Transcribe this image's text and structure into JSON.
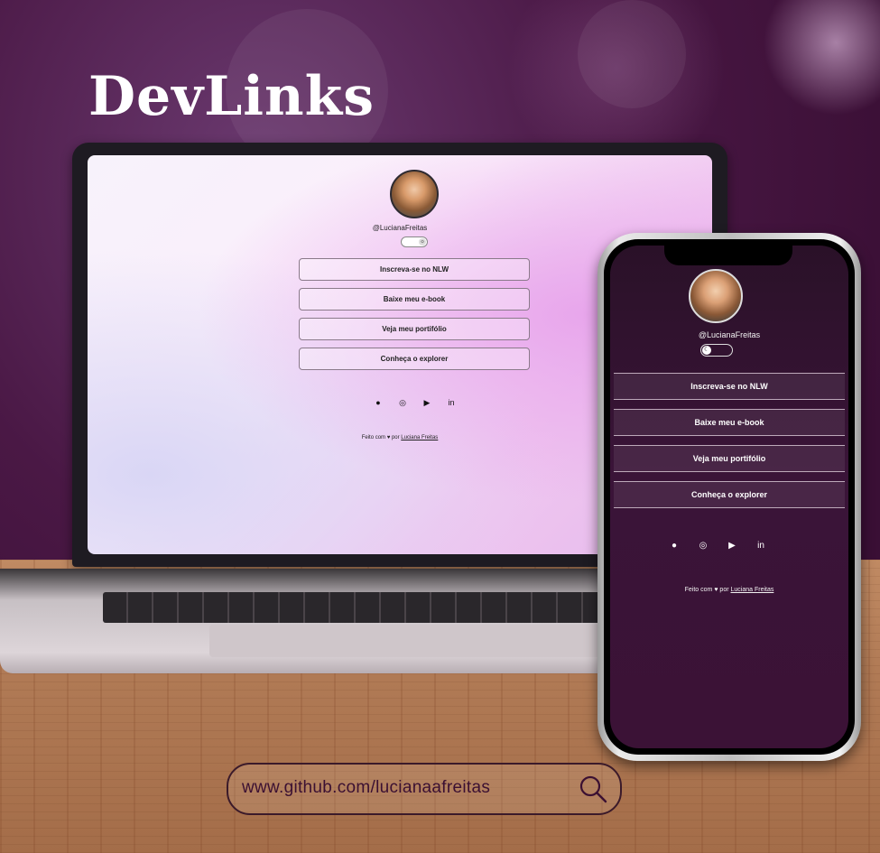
{
  "title": "DevLinks",
  "profile": {
    "username": "@LucianaFreitas"
  },
  "links": [
    {
      "label": "Inscreva-se no NLW"
    },
    {
      "label": "Baixe meu e-book"
    },
    {
      "label": "Veja meu portifólio"
    },
    {
      "label": "Conheça o explorer"
    }
  ],
  "socials": [
    {
      "icon": "github-icon",
      "glyph": "●"
    },
    {
      "icon": "instagram-icon",
      "glyph": "◎"
    },
    {
      "icon": "youtube-icon",
      "glyph": "▶"
    },
    {
      "icon": "linkedin-icon",
      "glyph": "in"
    }
  ],
  "footer": {
    "prefix": "Feito com",
    "heart": "♥",
    "by": "por",
    "author": "Luciana Freitas"
  },
  "search": {
    "text": "www.github.com/lucianaafreitas"
  },
  "colors": {
    "background": "#3a0f35",
    "phone_bg": "#3a1438",
    "accent_text": "#3b1032"
  }
}
